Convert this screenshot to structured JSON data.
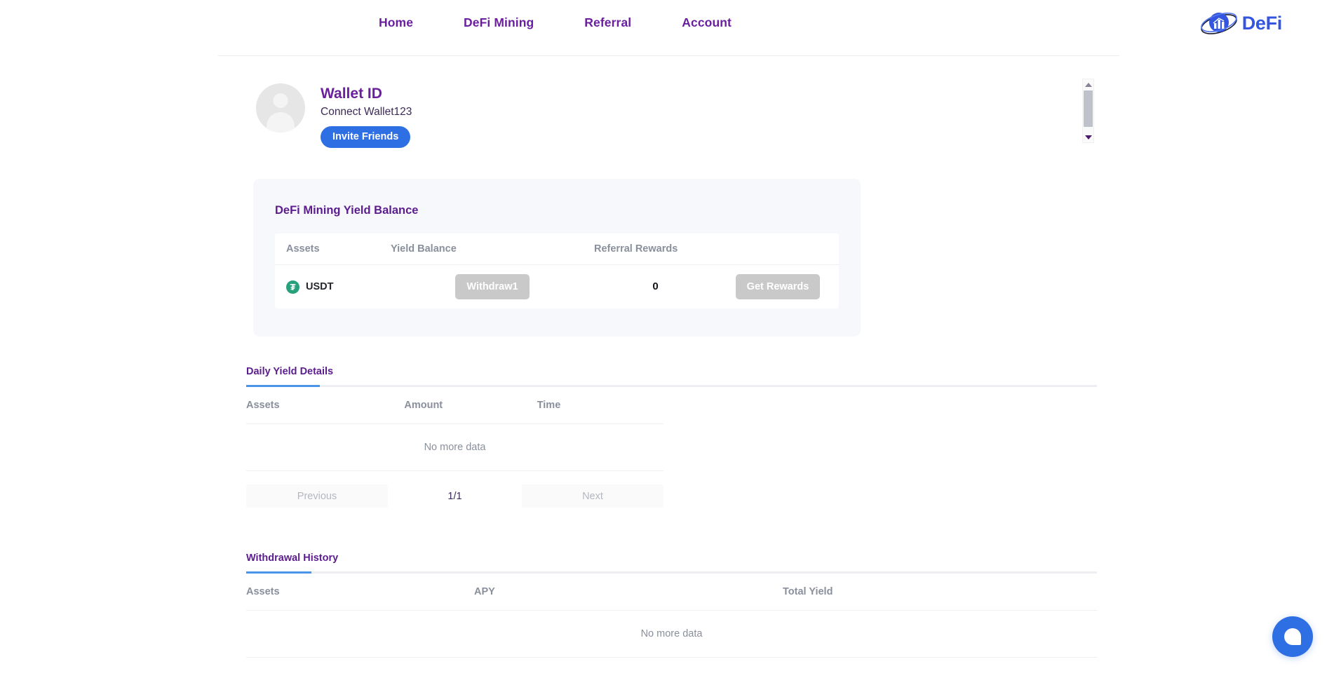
{
  "header": {
    "nav": [
      {
        "label": "Home",
        "name": "nav-home"
      },
      {
        "label": "DeFi Mining",
        "name": "nav-defi-mining"
      },
      {
        "label": "Referral",
        "name": "nav-referral"
      },
      {
        "label": "Account",
        "name": "nav-account"
      }
    ],
    "logo_text": "DeFi",
    "logo_icon": "defi-chart-orbit-logo",
    "accent_logo_color": "#3355e0"
  },
  "profile": {
    "avatar_icon": "user-avatar-placeholder",
    "wallet_id_label": "Wallet ID",
    "wallet_connect_text": "Connect Wallet123",
    "invite_button": "Invite Friends",
    "invite_button_color": "#2f6fe4"
  },
  "scrollbar": {
    "up_icon": "chevron-up-icon",
    "down_icon": "chevron-down-icon"
  },
  "yield_card": {
    "title": "DeFi Mining Yield Balance",
    "columns": [
      "Assets",
      "Yield Balance",
      "Referral Rewards"
    ],
    "row": {
      "asset_icon": "usdt-tether-icon",
      "asset_symbol": "USDT",
      "asset_icon_glyph": "₮",
      "asset_icon_color": "#26a17b",
      "yield_balance_value": "",
      "withdraw_button": "Withdraw1",
      "referral_rewards_value": "0",
      "get_rewards_button": "Get Rewards"
    }
  },
  "daily_yield": {
    "tab_label": "Daily Yield Details",
    "columns": [
      "Assets",
      "Amount",
      "Time"
    ],
    "empty_text": "No more data",
    "pagination": {
      "previous": "Previous",
      "page_indicator": "1/1",
      "next": "Next"
    }
  },
  "withdrawal_history": {
    "tab_label": "Withdrawal History",
    "columns": [
      "Assets",
      "APY",
      "Total Yield"
    ],
    "empty_text": "No more data"
  },
  "chat_widget": {
    "icon": "chat-bubble-icon",
    "color": "#2f6fe4"
  },
  "theme": {
    "primary_purple": "#6b1f9e",
    "accent_blue": "#4a95ea",
    "muted_gray": "#8a8f9c",
    "disabled_gray": "#c9c9c9"
  }
}
